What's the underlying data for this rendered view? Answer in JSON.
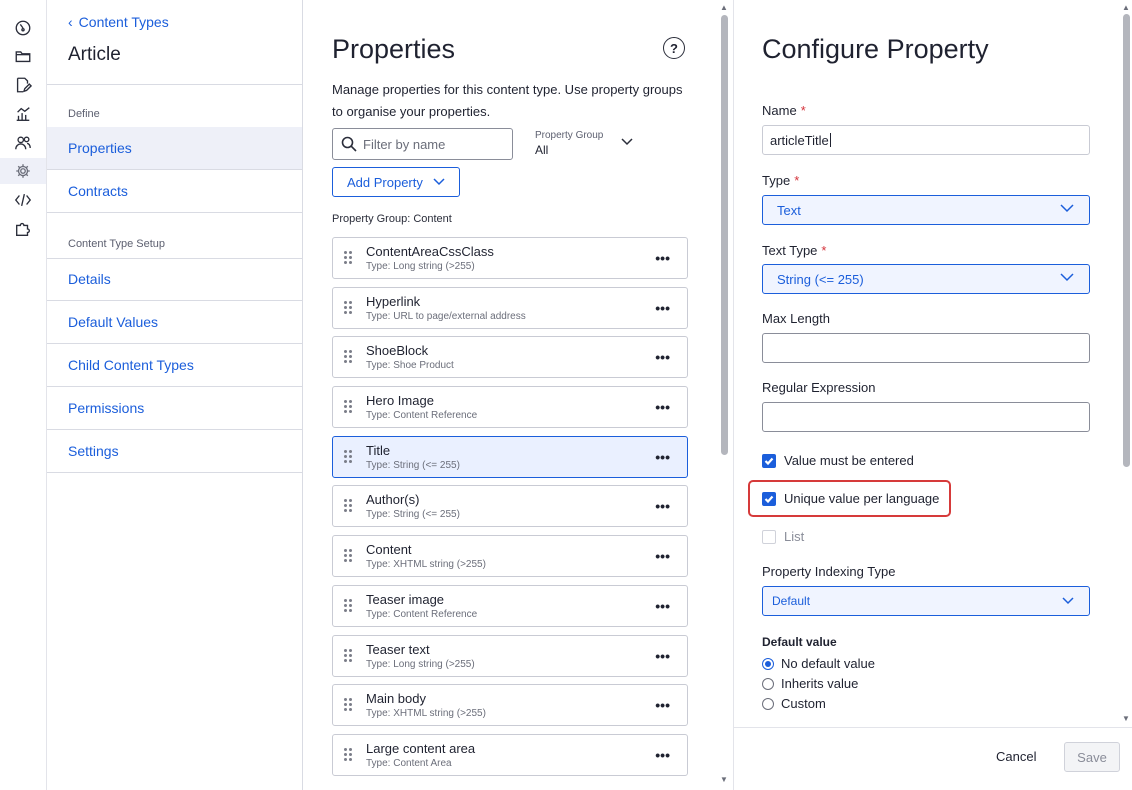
{
  "rail": {
    "icons": [
      "dashboard-icon",
      "folder-icon",
      "edit-icon",
      "analytics-icon",
      "users-icon",
      "settings-icon",
      "code-icon",
      "puzzle-icon"
    ]
  },
  "nav": {
    "back_label": "Content Types",
    "title": "Article",
    "define_heading": "Define",
    "define_items": [
      "Properties",
      "Contracts"
    ],
    "setup_heading": "Content Type Setup",
    "setup_items": [
      "Details",
      "Default Values",
      "Child Content Types",
      "Permissions",
      "Settings"
    ]
  },
  "properties": {
    "title": "Properties",
    "description": "Manage properties for this content type. Use property groups to organise your properties.",
    "filter_placeholder": "Filter by name",
    "property_group_label": "Property Group",
    "property_group_value": "All",
    "add_property_label": "Add Property",
    "group_label": "Property Group: Content",
    "items": [
      {
        "name": "ContentAreaCssClass",
        "type": "Type: Long string (>255)"
      },
      {
        "name": "Hyperlink",
        "type": "Type: URL to page/external address"
      },
      {
        "name": "ShoeBlock",
        "type": "Type: Shoe Product"
      },
      {
        "name": "Hero Image",
        "type": "Type: Content Reference"
      },
      {
        "name": "Title",
        "type": "Type: String (<= 255)"
      },
      {
        "name": "Author(s)",
        "type": "Type: String (<= 255)"
      },
      {
        "name": "Content",
        "type": "Type: XHTML string (>255)"
      },
      {
        "name": "Teaser image",
        "type": "Type: Content Reference"
      },
      {
        "name": "Teaser text",
        "type": "Type: Long string (>255)"
      },
      {
        "name": "Main body",
        "type": "Type: XHTML string (>255)"
      },
      {
        "name": "Large content area",
        "type": "Type: Content Area"
      }
    ],
    "selected_index": 4
  },
  "configure": {
    "title": "Configure Property",
    "name_label": "Name",
    "name_value": "articleTitle",
    "type_label": "Type",
    "type_value": "Text",
    "text_type_label": "Text Type",
    "text_type_value": "String (<= 255)",
    "max_length_label": "Max Length",
    "max_length_value": "",
    "regex_label": "Regular Expression",
    "regex_value": "",
    "value_required_label": "Value must be entered",
    "unique_label": "Unique value per language",
    "list_label": "List",
    "indexing_label": "Property Indexing Type",
    "indexing_value": "Default",
    "default_value_label": "Default value",
    "default_options": [
      "No default value",
      "Inherits value",
      "Custom"
    ],
    "cancel_label": "Cancel",
    "save_label": "Save"
  },
  "colors": {
    "accent": "#1b5edb",
    "required": "#d4323a",
    "highlight": "#d63a3a"
  }
}
